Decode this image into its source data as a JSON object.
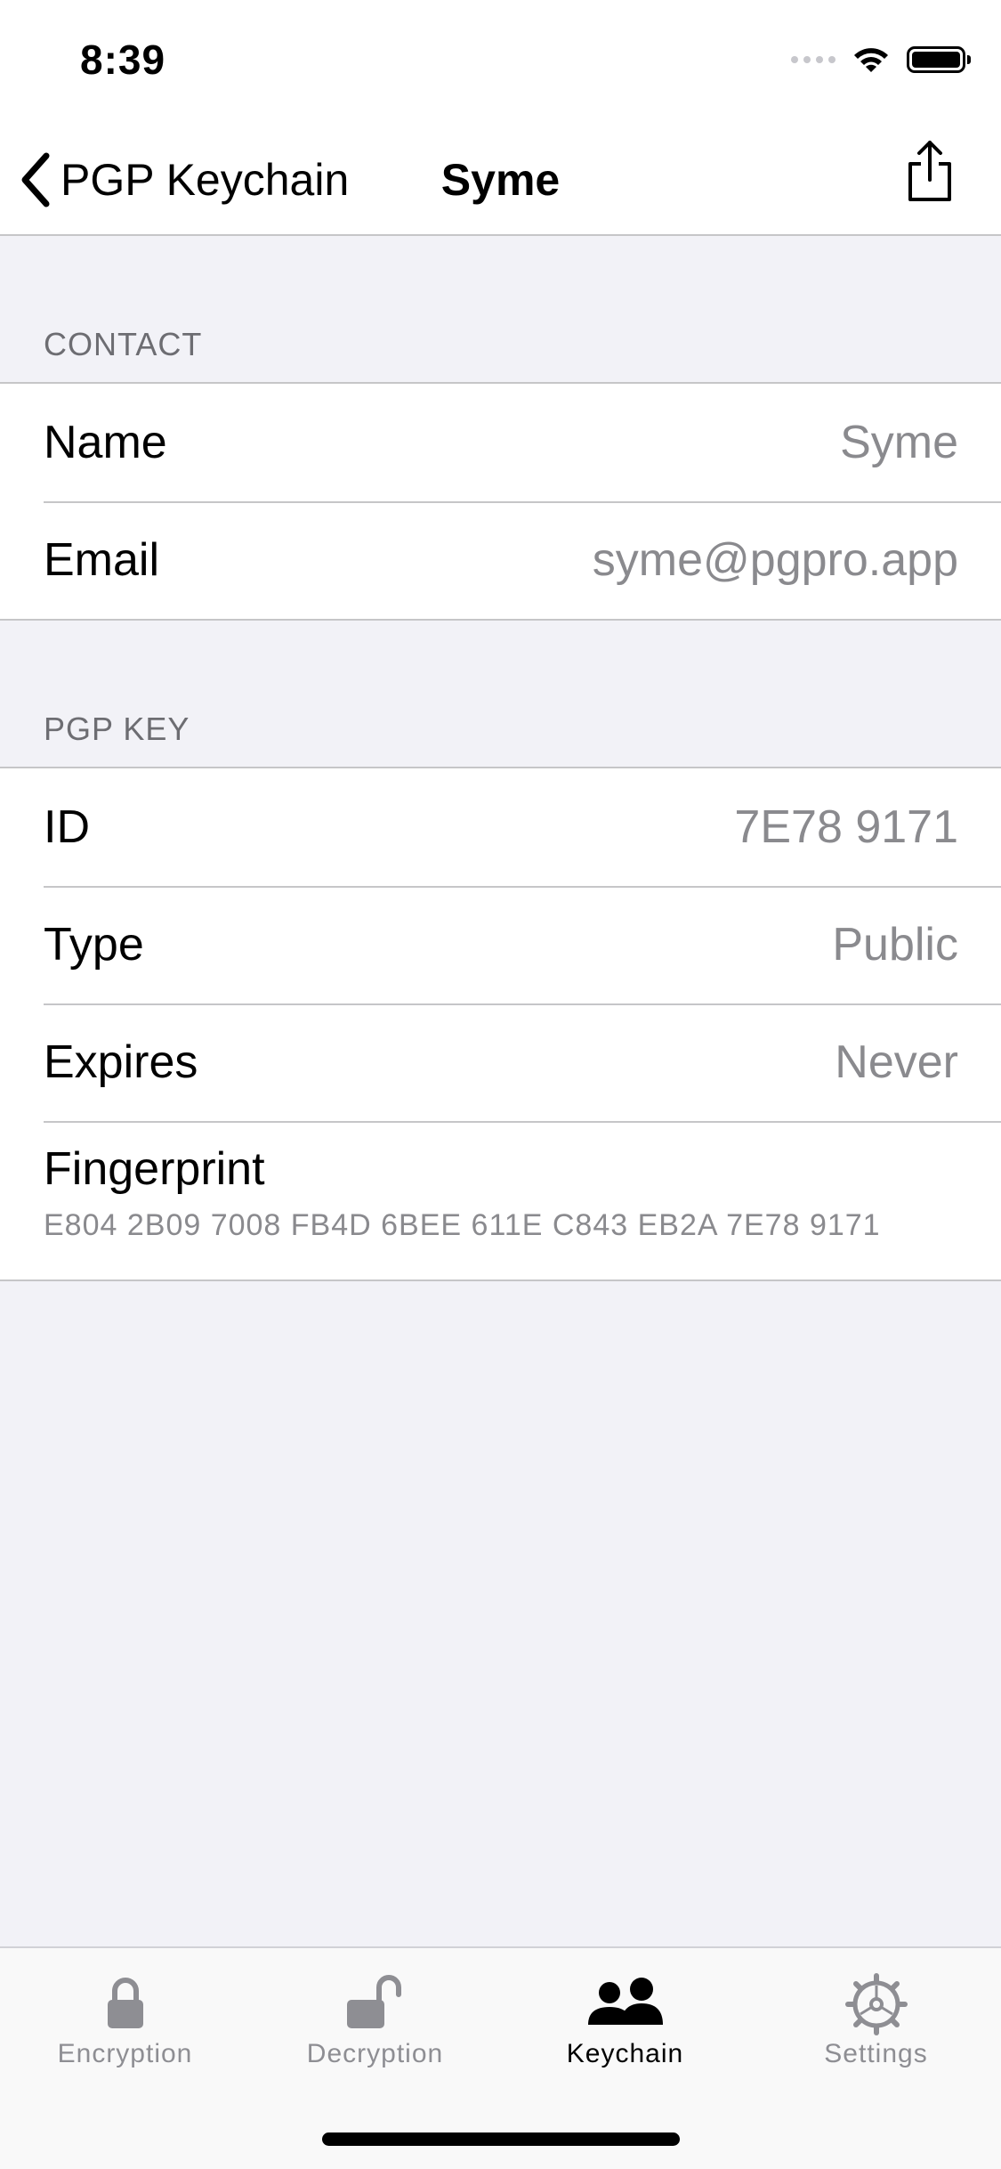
{
  "status_bar": {
    "time": "8:39"
  },
  "nav": {
    "back_label": "PGP Keychain",
    "title": "Syme",
    "share_icon": "share-icon"
  },
  "contact": {
    "header": "CONTACT",
    "rows": [
      {
        "label": "Name",
        "value": "Syme"
      },
      {
        "label": "Email",
        "value": "syme@pgpro.app"
      }
    ]
  },
  "pgp_key": {
    "header": "PGP KEY",
    "rows": [
      {
        "label": "ID",
        "value": "7E78 9171"
      },
      {
        "label": "Type",
        "value": "Public"
      },
      {
        "label": "Expires",
        "value": "Never"
      }
    ],
    "fingerprint": {
      "label": "Fingerprint",
      "value": "E804 2B09 7008 FB4D 6BEE 611E C843 EB2A 7E78 9171"
    }
  },
  "tabs": [
    {
      "label": "Encryption",
      "icon": "lock-icon",
      "active": false
    },
    {
      "label": "Decryption",
      "icon": "unlock-icon",
      "active": false
    },
    {
      "label": "Keychain",
      "icon": "people-icon",
      "active": true
    },
    {
      "label": "Settings",
      "icon": "gear-icon",
      "active": false
    }
  ],
  "colors": {
    "accent": "#000000",
    "inactive": "#8e8e93",
    "background": "#f2f2f7"
  }
}
